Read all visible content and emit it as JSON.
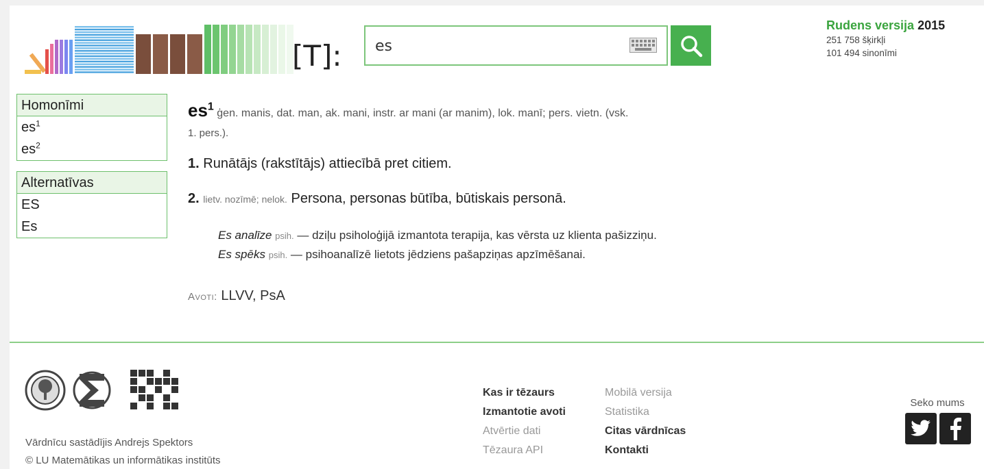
{
  "header": {
    "logo_mark": "[T]:",
    "search": {
      "value": "es"
    },
    "version": {
      "season": "Rudens versija",
      "year": "2015",
      "entries": "251 758 šķirkļi",
      "synonyms": "101 494 sinonīmi"
    }
  },
  "sidebar": {
    "homonyms": {
      "title": "Homonīmi",
      "items": [
        {
          "word": "es",
          "num": "1"
        },
        {
          "word": "es",
          "num": "2"
        }
      ]
    },
    "alternatives": {
      "title": "Alternatīvas",
      "items": [
        "ES",
        "Es"
      ]
    }
  },
  "entry": {
    "headword": "es",
    "homonym_num": "1",
    "grammar": "ģen. manis, dat. man, ak. mani, instr. ar mani (ar manim), lok. manī; pers. vietn. (vsk.",
    "grammar_cont": "1. pers.).",
    "senses": [
      {
        "num": "1.",
        "tags": "",
        "text": "Runātājs (rakstītājs) attiecībā pret citiem."
      },
      {
        "num": "2.",
        "tags": "lietv. nozīmē; nelok.",
        "text": "Persona, personas būtība, būtiskais personā."
      }
    ],
    "phrases": [
      {
        "phrase": "Es analīze",
        "tag": "psih.",
        "text": "— dziļu psiholoģijā izmantota terapija, kas vērsta uz klienta pašizziņu."
      },
      {
        "phrase": "Es spēks",
        "tag": "psih.",
        "text": "— psihoanalīzē lietots jēdziens pašapziņas apzīmēšanai."
      }
    ],
    "sources_label": "Avoti:",
    "sources": "LLVV, PsA"
  },
  "footer": {
    "author_line": "Vārdnīcu sastādījis Andrejs Spektors",
    "copyright_line": "© LU Matemātikas un informātikas institūts",
    "links_col1": [
      {
        "label": "Kas ir tēzaurs",
        "muted": false
      },
      {
        "label": "Izmantotie avoti",
        "muted": false
      },
      {
        "label": "Atvērtie dati",
        "muted": true
      },
      {
        "label": "Tēzaura API",
        "muted": true
      }
    ],
    "links_col2": [
      {
        "label": "Mobilā versija",
        "muted": true
      },
      {
        "label": "Statistika",
        "muted": true
      },
      {
        "label": "Citas vārdnīcas",
        "muted": false
      },
      {
        "label": "Kontakti",
        "muted": false
      }
    ],
    "follow_label": "Seko mums"
  },
  "colors": {
    "accent": "#47b04f",
    "border": "#6cbf6b",
    "head_bg": "#e9f5e6"
  }
}
